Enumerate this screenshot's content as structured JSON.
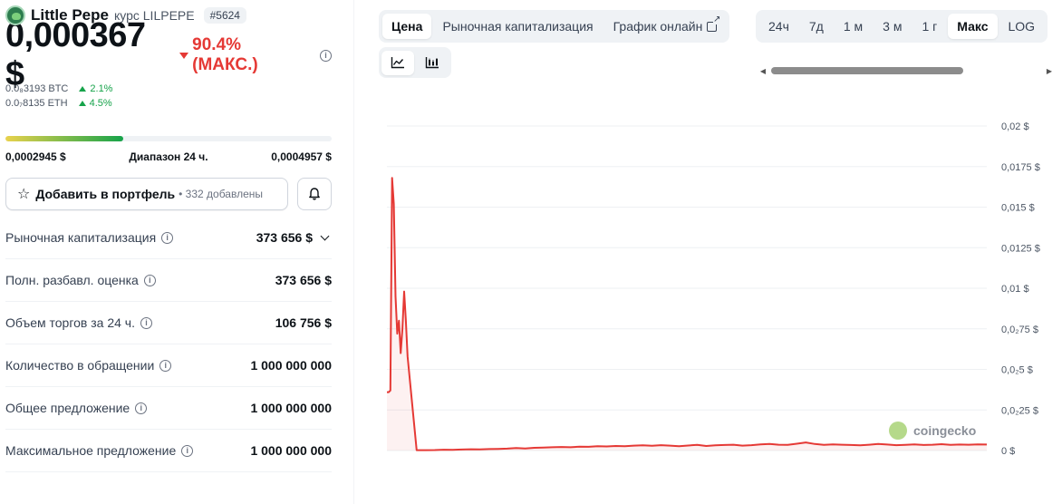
{
  "coin": {
    "name": "Little Pepe",
    "symbol_label": "курс LILPEPE",
    "rank": "#5624"
  },
  "price": {
    "value": "0,000367 $",
    "change": "90.4% (МАКС.)",
    "btc_value": "0.0₈3193 BTC",
    "btc_change": "2.1%",
    "eth_value": "0.0₇8135 ETH",
    "eth_change": "4.5%"
  },
  "range": {
    "low": "0,0002945 $",
    "label": "Диапазон 24 ч.",
    "high": "0,0004957 $",
    "fill_fraction": 0.36
  },
  "portfolio": {
    "button_label": "Добавить в портфель",
    "added_text": "• 332 добавлены"
  },
  "stats": [
    {
      "label": "Рыночная капитализация",
      "value": "373 656 $"
    },
    {
      "label": "Полн. разбавл. оценка",
      "value": "373 656 $"
    },
    {
      "label": "Объем торгов за 24 ч.",
      "value": "106 756 $"
    },
    {
      "label": "Количество в обращении",
      "value": "1 000 000 000"
    },
    {
      "label": "Общее предложение",
      "value": "1 000 000 000"
    },
    {
      "label": "Максимальное предложение",
      "value": "1 000 000 000"
    }
  ],
  "tabs": {
    "price": "Цена",
    "market_cap": "Рыночная капитализация",
    "live_chart": "График онлайн"
  },
  "ranges": [
    "24ч",
    "7д",
    "1 м",
    "3 м",
    "1 г",
    "Макс",
    "LOG"
  ],
  "active_range": "Макс",
  "colors": {
    "line": "#e53935",
    "positive": "#16a34a",
    "negative": "#e53935"
  },
  "chart_data": {
    "type": "line",
    "ylim": [
      0,
      0.02
    ],
    "y_ticks": [
      "0,02 $",
      "0,0175 $",
      "0,015 $",
      "0,0125 $",
      "0,01 $",
      "0,0₂75 $",
      "0,0₂5 $",
      "0,0₂25 $",
      "0 $"
    ],
    "watermark": "coingecko",
    "series": [
      {
        "values": [
          0.0036,
          0.0036,
          0.0037,
          0.0168,
          0.0152,
          0.0095,
          0.0072,
          0.008,
          0.006,
          0.0075,
          0.0098,
          0.008,
          0.0058,
          2e-05,
          2e-05,
          3e-05,
          5e-05,
          4e-05,
          6e-05,
          8e-05,
          7e-05,
          9e-05,
          0.0001,
          0.00012,
          0.00015,
          0.00013,
          0.00017,
          0.00018,
          0.0002,
          0.00022,
          0.0002,
          0.00024,
          0.00023,
          0.00026,
          0.00025,
          0.00028,
          0.00026,
          0.0003,
          0.00032,
          0.00029,
          0.00033,
          0.0003,
          0.00027,
          0.00031,
          0.00035,
          0.00028,
          0.00032,
          0.00034,
          0.00036,
          0.0003,
          0.00033,
          0.00038,
          0.0004,
          0.00036,
          0.00035,
          0.00042,
          0.0005,
          0.0004,
          0.00035,
          0.00038,
          0.00036,
          0.00034,
          0.00032,
          0.00036,
          0.0004,
          0.00037,
          0.00033,
          0.00035,
          0.00038,
          0.00034,
          0.00036,
          0.00039,
          0.00035,
          0.00037,
          0.00036,
          0.00038,
          0.00037
        ]
      }
    ]
  }
}
